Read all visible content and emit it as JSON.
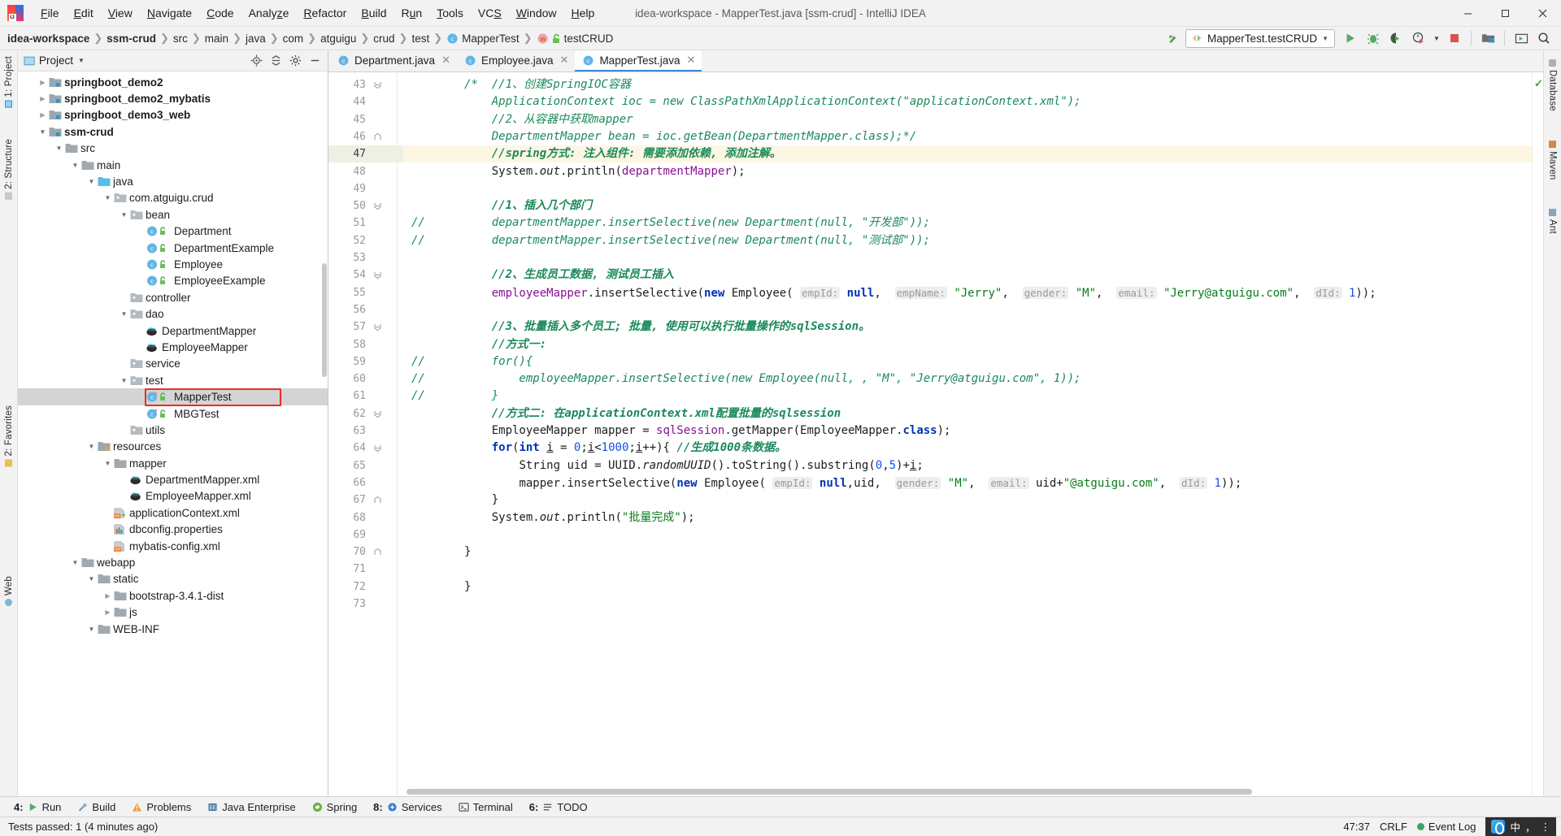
{
  "window": {
    "title": "idea-workspace - MapperTest.java [ssm-crud] - IntelliJ IDEA",
    "minimize_label": "—",
    "maximize_label": "❐",
    "close_label": "✕"
  },
  "menu": {
    "items": [
      {
        "label": "File",
        "pre": "F",
        "mid": "ile"
      },
      {
        "label": "Edit",
        "pre": "E",
        "mid": "dit"
      },
      {
        "label": "View",
        "pre": "V",
        "mid": "iew"
      },
      {
        "label": "Navigate",
        "pre": "N",
        "mid": "avigate"
      },
      {
        "label": "Code",
        "pre": "C",
        "mid": "ode"
      },
      {
        "label": "Analyze",
        "pre": "Analy",
        "mid": "ze"
      },
      {
        "label": "Refactor",
        "pre": "R",
        "mid": "efactor"
      },
      {
        "label": "Build",
        "pre": "B",
        "mid": "uild"
      },
      {
        "label": "Run",
        "pre": "R",
        "mid": "un"
      },
      {
        "label": "Tools",
        "pre": "T",
        "mid": "ools"
      },
      {
        "label": "VCS",
        "pre": "VC",
        "mid": "S"
      },
      {
        "label": "Window",
        "pre": "W",
        "mid": "indow"
      },
      {
        "label": "Help",
        "pre": "H",
        "mid": "elp"
      }
    ]
  },
  "breadcrumb": {
    "items": [
      {
        "label": "idea-workspace",
        "bold": true,
        "icon": ""
      },
      {
        "label": "ssm-crud",
        "bold": true,
        "icon": ""
      },
      {
        "label": "src",
        "bold": false,
        "icon": ""
      },
      {
        "label": "main",
        "bold": false,
        "icon": ""
      },
      {
        "label": "java",
        "bold": false,
        "icon": ""
      },
      {
        "label": "com",
        "bold": false,
        "icon": ""
      },
      {
        "label": "atguigu",
        "bold": false,
        "icon": ""
      },
      {
        "label": "crud",
        "bold": false,
        "icon": ""
      },
      {
        "label": "test",
        "bold": false,
        "icon": ""
      },
      {
        "label": "MapperTest",
        "bold": false,
        "icon": "class-icon"
      },
      {
        "label": "testCRUD",
        "bold": false,
        "icon": "method-icon"
      }
    ]
  },
  "toolbar": {
    "run_config": "MapperTest.testCRUD",
    "buttons": [
      {
        "name": "update-project-icon",
        "title": "Update Project"
      },
      {
        "name": "run-icon",
        "title": "Run"
      },
      {
        "name": "debug-icon",
        "title": "Debug"
      },
      {
        "name": "run-coverage-icon",
        "title": "Run with Coverage"
      },
      {
        "name": "profile-icon",
        "title": "Profile"
      },
      {
        "name": "stop-icon",
        "title": "Stop"
      },
      {
        "name": "project-structure-icon",
        "title": "Project Structure"
      },
      {
        "name": "settings-layout-icon",
        "title": "Layout"
      },
      {
        "name": "search-everywhere-icon",
        "title": "Search Everywhere"
      }
    ]
  },
  "left_strip": {
    "tabs": [
      {
        "label": "1: Project",
        "name": "tool-tab-project"
      },
      {
        "label": "2: Structure",
        "name": "tool-tab-structure"
      },
      {
        "label": "2: Favorites",
        "name": "tool-tab-favorites"
      },
      {
        "label": "Web",
        "name": "tool-tab-web"
      }
    ]
  },
  "right_strip": {
    "tabs": [
      {
        "label": "Database",
        "name": "tool-tab-database"
      },
      {
        "label": "Maven",
        "name": "tool-tab-maven"
      },
      {
        "label": "Ant",
        "name": "tool-tab-ant"
      }
    ]
  },
  "project_panel": {
    "title": "Project",
    "actions": [
      {
        "name": "locate-icon",
        "label": "Select Opened File"
      },
      {
        "name": "collapse-all-icon",
        "label": "Collapse All"
      },
      {
        "name": "settings-gear-icon",
        "label": "Settings"
      },
      {
        "name": "hide-icon",
        "label": "Hide"
      }
    ],
    "tree": [
      {
        "indent": 1,
        "arrow": "right",
        "icon": "module",
        "label": "springboot_demo2",
        "bold": true,
        "selected": false
      },
      {
        "indent": 1,
        "arrow": "right",
        "icon": "module",
        "label": "springboot_demo2_mybatis",
        "bold": true,
        "selected": false
      },
      {
        "indent": 1,
        "arrow": "right",
        "icon": "module",
        "label": "springboot_demo3_web",
        "bold": true,
        "selected": false
      },
      {
        "indent": 1,
        "arrow": "down",
        "icon": "module",
        "label": "ssm-crud",
        "bold": true,
        "selected": false
      },
      {
        "indent": 2,
        "arrow": "down",
        "icon": "folder",
        "label": "src",
        "bold": false,
        "selected": false
      },
      {
        "indent": 3,
        "arrow": "down",
        "icon": "folder",
        "label": "main",
        "bold": false,
        "selected": false
      },
      {
        "indent": 4,
        "arrow": "down",
        "icon": "source",
        "label": "java",
        "bold": false,
        "selected": false
      },
      {
        "indent": 5,
        "arrow": "down",
        "icon": "package",
        "label": "com.atguigu.crud",
        "bold": false,
        "selected": false
      },
      {
        "indent": 6,
        "arrow": "down",
        "icon": "package",
        "label": "bean",
        "bold": false,
        "selected": false
      },
      {
        "indent": 7,
        "arrow": "none",
        "icon": "class",
        "label": "Department",
        "bold": false,
        "selected": false
      },
      {
        "indent": 7,
        "arrow": "none",
        "icon": "class",
        "label": "DepartmentExample",
        "bold": false,
        "selected": false
      },
      {
        "indent": 7,
        "arrow": "none",
        "icon": "class",
        "label": "Employee",
        "bold": false,
        "selected": false
      },
      {
        "indent": 7,
        "arrow": "none",
        "icon": "class",
        "label": "EmployeeExample",
        "bold": false,
        "selected": false
      },
      {
        "indent": 6,
        "arrow": "none",
        "icon": "package",
        "label": "controller",
        "bold": false,
        "selected": false
      },
      {
        "indent": 6,
        "arrow": "down",
        "icon": "package",
        "label": "dao",
        "bold": false,
        "selected": false
      },
      {
        "indent": 7,
        "arrow": "none",
        "icon": "mybatis",
        "label": "DepartmentMapper",
        "bold": false,
        "selected": false
      },
      {
        "indent": 7,
        "arrow": "none",
        "icon": "mybatis",
        "label": "EmployeeMapper",
        "bold": false,
        "selected": false
      },
      {
        "indent": 6,
        "arrow": "none",
        "icon": "package",
        "label": "service",
        "bold": false,
        "selected": false
      },
      {
        "indent": 6,
        "arrow": "down",
        "icon": "package",
        "label": "test",
        "bold": false,
        "selected": false
      },
      {
        "indent": 7,
        "arrow": "none",
        "icon": "testclass",
        "label": "MapperTest",
        "bold": false,
        "selected": true
      },
      {
        "indent": 7,
        "arrow": "none",
        "icon": "testclass",
        "label": "MBGTest",
        "bold": false,
        "selected": false
      },
      {
        "indent": 6,
        "arrow": "none",
        "icon": "package",
        "label": "utils",
        "bold": false,
        "selected": false
      },
      {
        "indent": 4,
        "arrow": "down",
        "icon": "resource",
        "label": "resources",
        "bold": false,
        "selected": false
      },
      {
        "indent": 5,
        "arrow": "down",
        "icon": "folder",
        "label": "mapper",
        "bold": false,
        "selected": false
      },
      {
        "indent": 6,
        "arrow": "none",
        "icon": "mybatis",
        "label": "DepartmentMapper.xml",
        "bold": false,
        "selected": false
      },
      {
        "indent": 6,
        "arrow": "none",
        "icon": "mybatis",
        "label": "EmployeeMapper.xml",
        "bold": false,
        "selected": false
      },
      {
        "indent": 5,
        "arrow": "none",
        "icon": "springxml",
        "label": "applicationContext.xml",
        "bold": false,
        "selected": false
      },
      {
        "indent": 5,
        "arrow": "none",
        "icon": "props",
        "label": "dbconfig.properties",
        "bold": false,
        "selected": false
      },
      {
        "indent": 5,
        "arrow": "none",
        "icon": "xml",
        "label": "mybatis-config.xml",
        "bold": false,
        "selected": false
      },
      {
        "indent": 3,
        "arrow": "down",
        "icon": "folder",
        "label": "webapp",
        "bold": false,
        "selected": false
      },
      {
        "indent": 4,
        "arrow": "down",
        "icon": "folder",
        "label": "static",
        "bold": false,
        "selected": false
      },
      {
        "indent": 5,
        "arrow": "right",
        "icon": "folder",
        "label": "bootstrap-3.4.1-dist",
        "bold": false,
        "selected": false
      },
      {
        "indent": 5,
        "arrow": "right",
        "icon": "folder",
        "label": "js",
        "bold": false,
        "selected": false
      },
      {
        "indent": 4,
        "arrow": "down",
        "icon": "folder",
        "label": "WEB-INF",
        "bold": false,
        "selected": false
      }
    ]
  },
  "editor": {
    "tabs": [
      {
        "label": "Department.java",
        "icon": "class-icon",
        "active": false,
        "closable": true
      },
      {
        "label": "Employee.java",
        "icon": "class-icon",
        "active": false,
        "closable": true
      },
      {
        "label": "MapperTest.java",
        "icon": "class-icon",
        "active": true,
        "closable": true
      }
    ],
    "first_line": 43,
    "last_line": 73,
    "highlighted_line": 47,
    "fold_lines": [
      43,
      46,
      50,
      54,
      57,
      62,
      64,
      67,
      70
    ],
    "lines": [
      {
        "n": 43,
        "html": "<span class=\"c-cmt\">/*  //1、创建SpringIOC容器</span>"
      },
      {
        "n": 44,
        "html": "<span class=\"c-cmt\">    ApplicationContext ioc = new ClassPathXmlApplicationContext(\"applicationContext.xml\");</span>"
      },
      {
        "n": 45,
        "html": "<span class=\"c-cmt\">    //2、从容器中获取mapper</span>"
      },
      {
        "n": 46,
        "html": "<span class=\"c-cmt\">    DepartmentMapper bean = ioc.getBean(DepartmentMapper.class);*/</span>"
      },
      {
        "n": 47,
        "html": "<span class=\"c-cmtb\">    //spring方式: 注入组件: 需要添加依赖, 添加注解。</span>"
      },
      {
        "n": 48,
        "html": "    <span class=\"c-txt\">System.</span><span class=\"c-stat\">out</span><span class=\"c-txt\">.println(</span><span class=\"c-fld\">departmentMapper</span><span class=\"c-txt\">);</span>"
      },
      {
        "n": 49,
        "html": ""
      },
      {
        "n": 50,
        "html": "<span class=\"c-cmtb\">    //1、插入几个部门</span>"
      },
      {
        "n": 51,
        "html": "<span class=\"c-cmt\">    departmentMapper.insertSelective(new Department(null, \"开发部\"));</span>",
        "commented": true
      },
      {
        "n": 52,
        "html": "<span class=\"c-cmt\">    departmentMapper.insertSelective(new Department(null, \"测试部\"));</span>",
        "commented": true
      },
      {
        "n": 53,
        "html": ""
      },
      {
        "n": 54,
        "html": "<span class=\"c-cmtb\">    //2、生成员工数据, 测试员工插入</span>"
      },
      {
        "n": 55,
        "html": "    <span class=\"c-fld\">employeeMapper</span><span class=\"c-txt\">.insertSelective(</span><span class=\"c-kw\">new</span><span class=\"c-txt\"> Employee( </span><span class=\"c-hint\">empId:</span><span class=\"c-txt\"> </span><span class=\"c-kw\">null</span><span class=\"c-txt\">,  </span><span class=\"c-hint\">empName:</span><span class=\"c-txt\"> </span><span class=\"c-str\">\"Jerry\"</span><span class=\"c-txt\">,  </span><span class=\"c-hint\">gender:</span><span class=\"c-txt\"> </span><span class=\"c-str\">\"M\"</span><span class=\"c-txt\">,  </span><span class=\"c-hint\">email:</span><span class=\"c-txt\"> </span><span class=\"c-str\">\"Jerry@atguigu.com\"</span><span class=\"c-txt\">,  </span><span class=\"c-hint\">dId:</span><span class=\"c-txt\"> </span><span class=\"c-num\">1</span><span class=\"c-txt\">));</span>"
      },
      {
        "n": 56,
        "html": ""
      },
      {
        "n": 57,
        "html": "<span class=\"c-cmtb\">    //3、批量插入多个员工; 批量, 使用可以执行批量操作的sqlSession。</span>"
      },
      {
        "n": 58,
        "html": "<span class=\"c-cmtb\">    //方式一:</span>"
      },
      {
        "n": 59,
        "html": "<span class=\"c-cmt\">    for(){</span>",
        "commented": true
      },
      {
        "n": 60,
        "html": "<span class=\"c-cmt\">        employeeMapper.insertSelective(new Employee(null, , \"M\", \"Jerry@atguigu.com\", 1));</span>",
        "commented": true
      },
      {
        "n": 61,
        "html": "<span class=\"c-cmt\">    }</span>",
        "commented": true
      },
      {
        "n": 62,
        "html": "<span class=\"c-cmtb\">    //方式二: 在applicationContext.xml配置批量的sqlsession</span>"
      },
      {
        "n": 63,
        "html": "    <span class=\"c-txt\">EmployeeMapper mapper = </span><span class=\"c-fld\">sqlSession</span><span class=\"c-txt\">.getMapper(EmployeeMapper.</span><span class=\"c-kw\">class</span><span class=\"c-txt\">);</span>"
      },
      {
        "n": 64,
        "html": "    <span class=\"c-kw\">for</span><span class=\"c-txt\">(</span><span class=\"c-kw\">int</span><span class=\"c-txt\"> </span><span class=\"c-var-u\">i</span><span class=\"c-txt\"> = </span><span class=\"c-num\">0</span><span class=\"c-txt\">;</span><span class=\"c-var-u\">i</span><span class=\"c-txt\">&lt;</span><span class=\"c-num\">1000</span><span class=\"c-txt\">;</span><span class=\"c-var-u\">i</span><span class=\"c-txt\">++){ </span><span class=\"c-cmtb\">//生成1000条数据。</span>"
      },
      {
        "n": 65,
        "html": "        <span class=\"c-txt\">String uid = UUID.</span><span class=\"c-stat\">randomUUID</span><span class=\"c-txt\">().toString().substring(</span><span class=\"c-num\">0</span><span class=\"c-txt\">,</span><span class=\"c-num\">5</span><span class=\"c-txt\">)+</span><span class=\"c-var-u\">i</span><span class=\"c-txt\">;</span>"
      },
      {
        "n": 66,
        "html": "        <span class=\"c-txt\">mapper.insertSelective(</span><span class=\"c-kw\">new</span><span class=\"c-txt\"> Employee( </span><span class=\"c-hint\">empId:</span><span class=\"c-txt\"> </span><span class=\"c-kw\">null</span><span class=\"c-txt\">,uid,  </span><span class=\"c-hint\">gender:</span><span class=\"c-txt\"> </span><span class=\"c-str\">\"M\"</span><span class=\"c-txt\">,  </span><span class=\"c-hint\">email:</span><span class=\"c-txt\"> </span><span class=\"c-txt\">uid+</span><span class=\"c-str\">\"@atguigu.com\"</span><span class=\"c-txt\">,  </span><span class=\"c-hint\">dId:</span><span class=\"c-txt\"> </span><span class=\"c-num\">1</span><span class=\"c-txt\">));</span>"
      },
      {
        "n": 67,
        "html": "    <span class=\"c-txt\">}</span>"
      },
      {
        "n": 68,
        "html": "    <span class=\"c-txt\">System.</span><span class=\"c-stat\">out</span><span class=\"c-txt\">.println(</span><span class=\"c-str\">\"批量完成\"</span><span class=\"c-txt\">);</span>"
      },
      {
        "n": 69,
        "html": ""
      },
      {
        "n": 70,
        "html": "<span class=\"c-txt\">}</span>"
      },
      {
        "n": 71,
        "html": ""
      },
      {
        "n": 72,
        "html": "<span class=\"c-txt\">}</span>"
      },
      {
        "n": 73,
        "html": ""
      }
    ]
  },
  "tool_windows": {
    "items": [
      {
        "num": "4:",
        "label": "Run",
        "icon": "run-icon"
      },
      {
        "num": "",
        "label": "Build",
        "icon": "build-icon"
      },
      {
        "num": "",
        "label": "Problems",
        "icon": "warning-icon"
      },
      {
        "num": "",
        "label": "Java Enterprise",
        "icon": "java-ee-icon"
      },
      {
        "num": "",
        "label": "Spring",
        "icon": "spring-icon"
      },
      {
        "num": "8:",
        "label": "Services",
        "icon": "services-icon"
      },
      {
        "num": "",
        "label": "Terminal",
        "icon": "terminal-icon"
      },
      {
        "num": "6:",
        "label": "TODO",
        "icon": "todo-icon"
      }
    ]
  },
  "status_bar": {
    "message": "Tests passed: 1 (4 minutes ago)",
    "caret_position": "47:37",
    "line_separator": "CRLF",
    "event_log": "Event Log",
    "ime": {
      "lang": "中",
      "punct": "，",
      "menu": "⋮"
    }
  }
}
